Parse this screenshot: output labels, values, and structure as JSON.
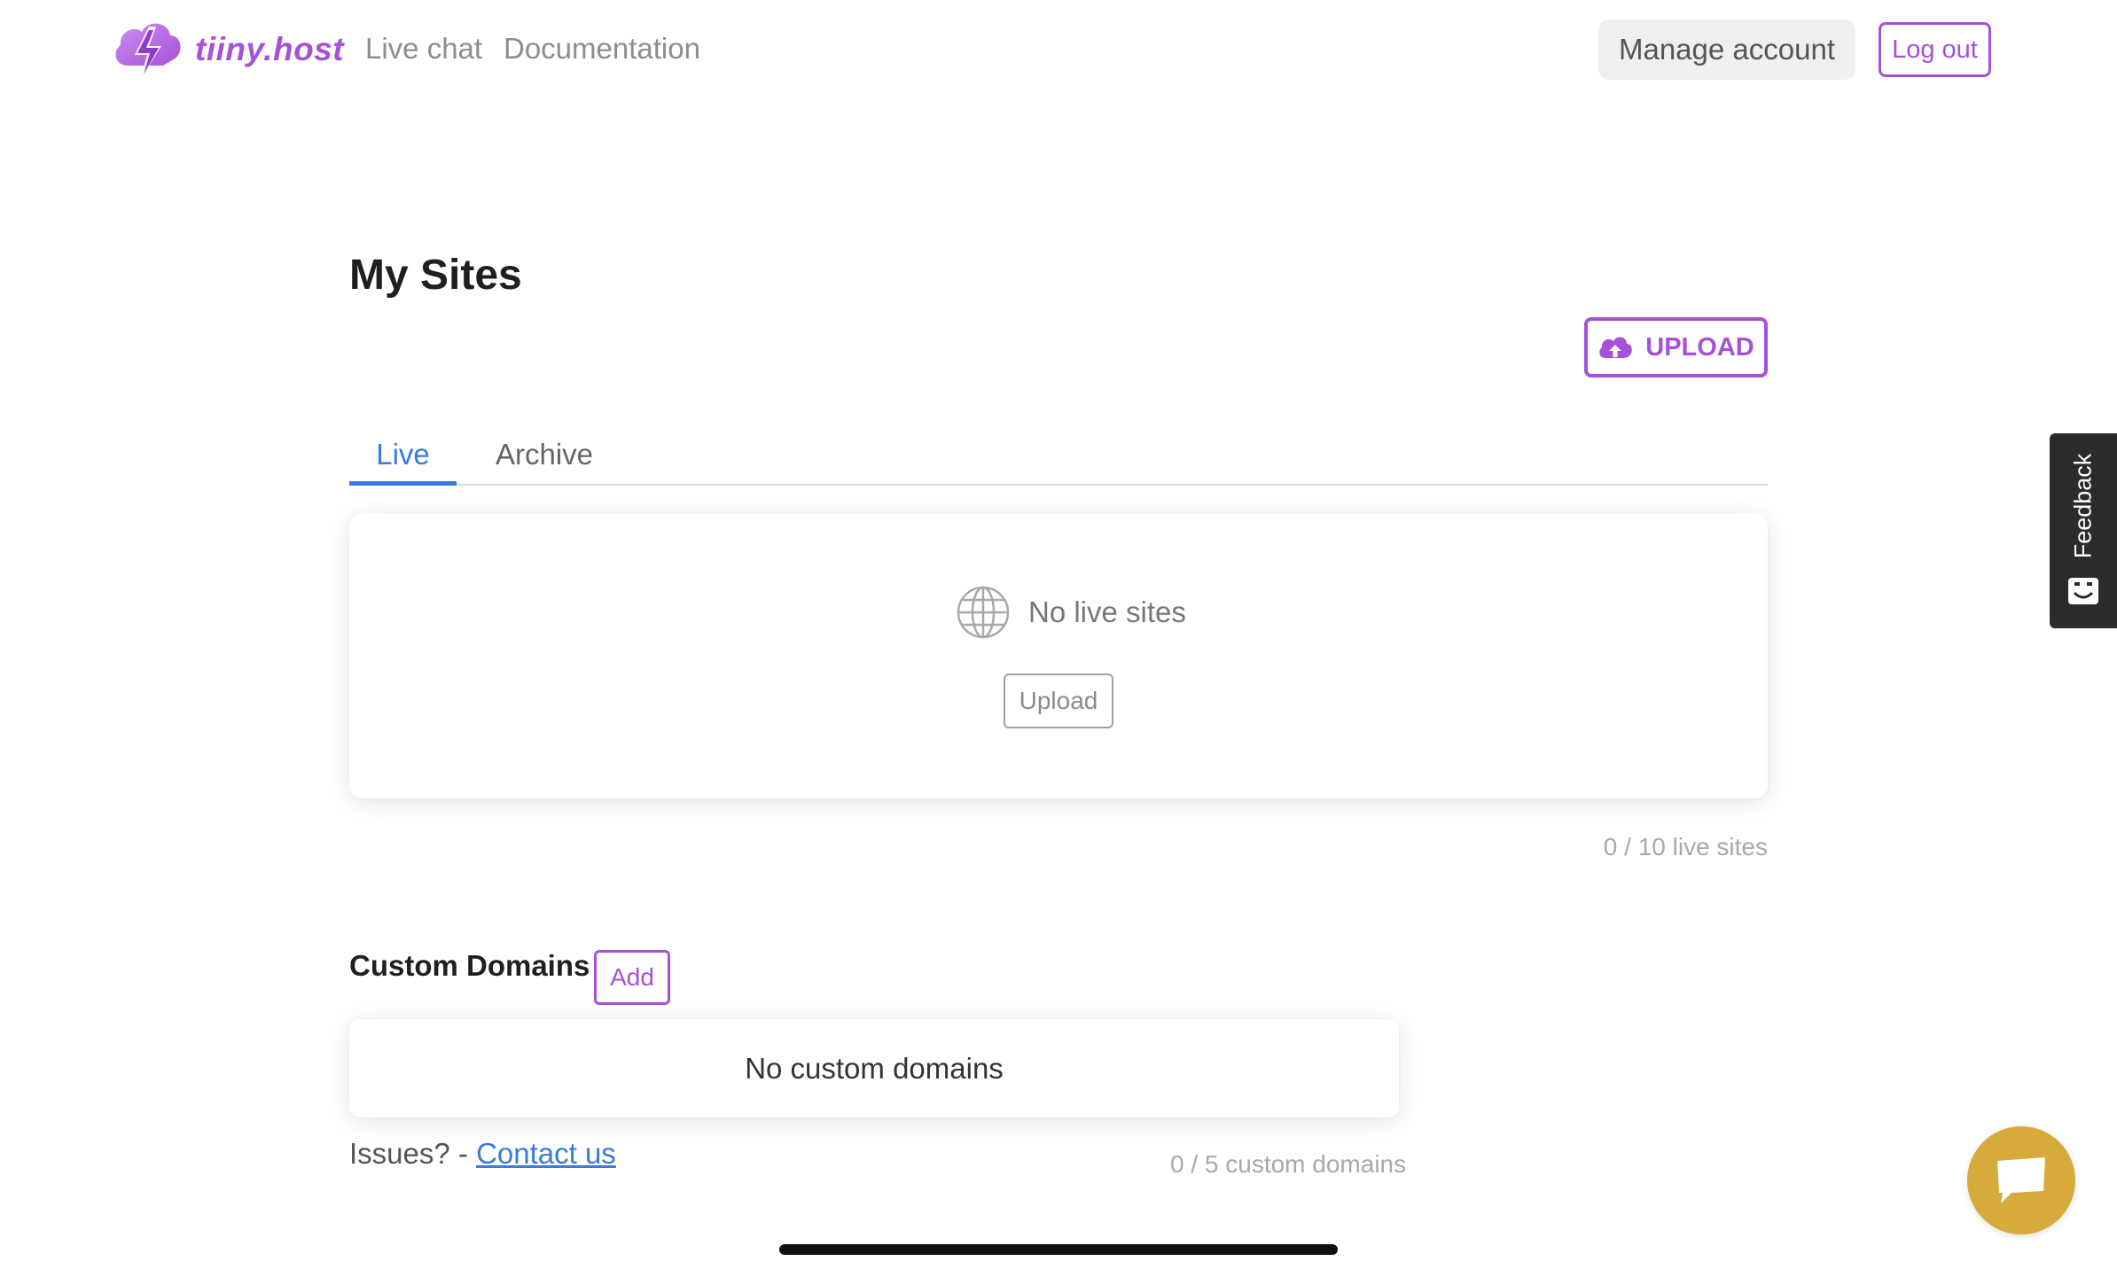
{
  "header": {
    "logo_text": "tiiny.host",
    "nav": [
      {
        "label": "Live chat"
      },
      {
        "label": "Documentation"
      }
    ],
    "manage_account_label": "Manage account",
    "logout_label": "Log out"
  },
  "main": {
    "title": "My Sites",
    "upload_label": "UPLOAD",
    "tabs": [
      {
        "label": "Live",
        "active": true
      },
      {
        "label": "Archive",
        "active": false
      }
    ],
    "live_card": {
      "empty_text": "No live sites",
      "upload_label": "Upload"
    },
    "live_count": "0 / 10 live sites"
  },
  "domains": {
    "title": "Custom Domains",
    "add_label": "Add",
    "empty_text": "No custom domains",
    "count": "0 / 5 custom domains",
    "issues_text": "Issues? - ",
    "contact_label": "Contact us"
  },
  "feedback": {
    "label": "Feedback"
  },
  "colors": {
    "brand": "#a651d8",
    "accent": "#3a7bd5",
    "chat": "#d6aa3b"
  }
}
